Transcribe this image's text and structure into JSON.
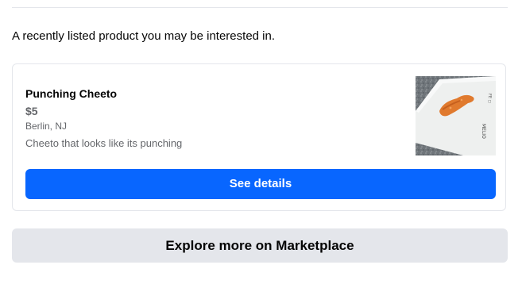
{
  "intro_text": "A recently listed product you may be interested in.",
  "listing": {
    "title": "Punching Cheeto",
    "price": "$5",
    "location": "Berlin, NJ",
    "description": "Cheeto that looks like its punching",
    "image_alt": "cheeto-on-plate-photo"
  },
  "buttons": {
    "see_details": "See details",
    "explore_more": "Explore more on Marketplace"
  },
  "colors": {
    "primary": "#0866ff",
    "secondary_bg": "#e4e6eb",
    "secondary_text": "#65676b"
  }
}
